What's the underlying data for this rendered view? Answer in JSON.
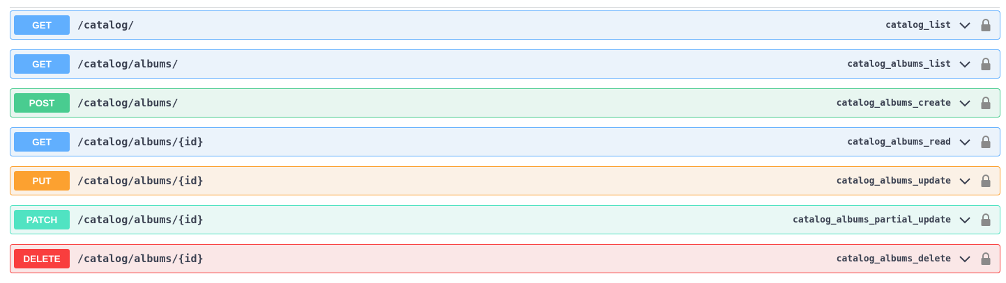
{
  "colors": {
    "GET": {
      "badge": "#61affe",
      "bg": "#ebf3fb",
      "border": "#61affe"
    },
    "POST": {
      "badge": "#49cc90",
      "bg": "#e8f6f0",
      "border": "#49cc90"
    },
    "PUT": {
      "badge": "#fca130",
      "bg": "#fbf1e6",
      "border": "#fca130"
    },
    "PATCH": {
      "badge": "#50e3c2",
      "bg": "#e9f8f5",
      "border": "#50e3c2"
    },
    "DELETE": {
      "badge": "#f93e3e",
      "bg": "#fae7e7",
      "border": "#f93e3e"
    }
  },
  "operations": [
    {
      "method": "GET",
      "path": "/catalog/",
      "operation_id": "catalog_list",
      "icons": [
        "chevron-down-icon",
        "lock-icon"
      ]
    },
    {
      "method": "GET",
      "path": "/catalog/albums/",
      "operation_id": "catalog_albums_list",
      "icons": [
        "chevron-down-icon",
        "lock-icon"
      ]
    },
    {
      "method": "POST",
      "path": "/catalog/albums/",
      "operation_id": "catalog_albums_create",
      "icons": [
        "chevron-down-icon",
        "lock-icon"
      ]
    },
    {
      "method": "GET",
      "path": "/catalog/albums/{id}",
      "operation_id": "catalog_albums_read",
      "icons": [
        "chevron-down-icon",
        "lock-icon"
      ]
    },
    {
      "method": "PUT",
      "path": "/catalog/albums/{id}",
      "operation_id": "catalog_albums_update",
      "icons": [
        "chevron-down-icon",
        "lock-icon"
      ]
    },
    {
      "method": "PATCH",
      "path": "/catalog/albums/{id}",
      "operation_id": "catalog_albums_partial_update",
      "icons": [
        "chevron-down-icon",
        "lock-icon"
      ]
    },
    {
      "method": "DELETE",
      "path": "/catalog/albums/{id}",
      "operation_id": "catalog_albums_delete",
      "icons": [
        "chevron-down-icon",
        "lock-icon"
      ]
    }
  ]
}
